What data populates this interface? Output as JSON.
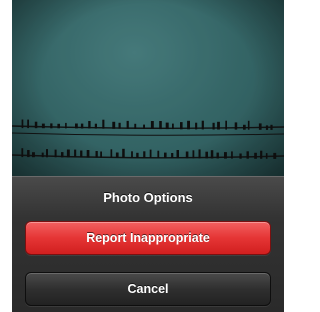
{
  "action_sheet": {
    "title": "Photo Options",
    "report_label": "Report Inappropriate",
    "cancel_label": "Cancel"
  },
  "colors": {
    "destructive": "#e53535",
    "sheet_background": "#333333",
    "photo_sky": "#3e7677"
  }
}
